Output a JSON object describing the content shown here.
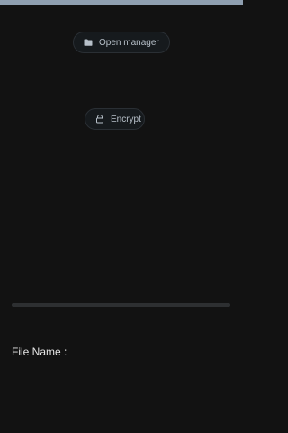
{
  "app": {
    "title": ""
  },
  "buttons": {
    "open_manager": {
      "label": "Open manager",
      "icon": "folder-icon"
    },
    "encrypt": {
      "label": "Encrypt",
      "icon": "lock-icon"
    }
  },
  "progress": {
    "value": 0
  },
  "file": {
    "label": "File Name :",
    "value": ""
  },
  "colors": {
    "background": "#121212",
    "accent": "#8f9fb0",
    "button_bg": "#161a1d",
    "button_text": "#b7c0c9",
    "text": "#e6e6e6"
  }
}
